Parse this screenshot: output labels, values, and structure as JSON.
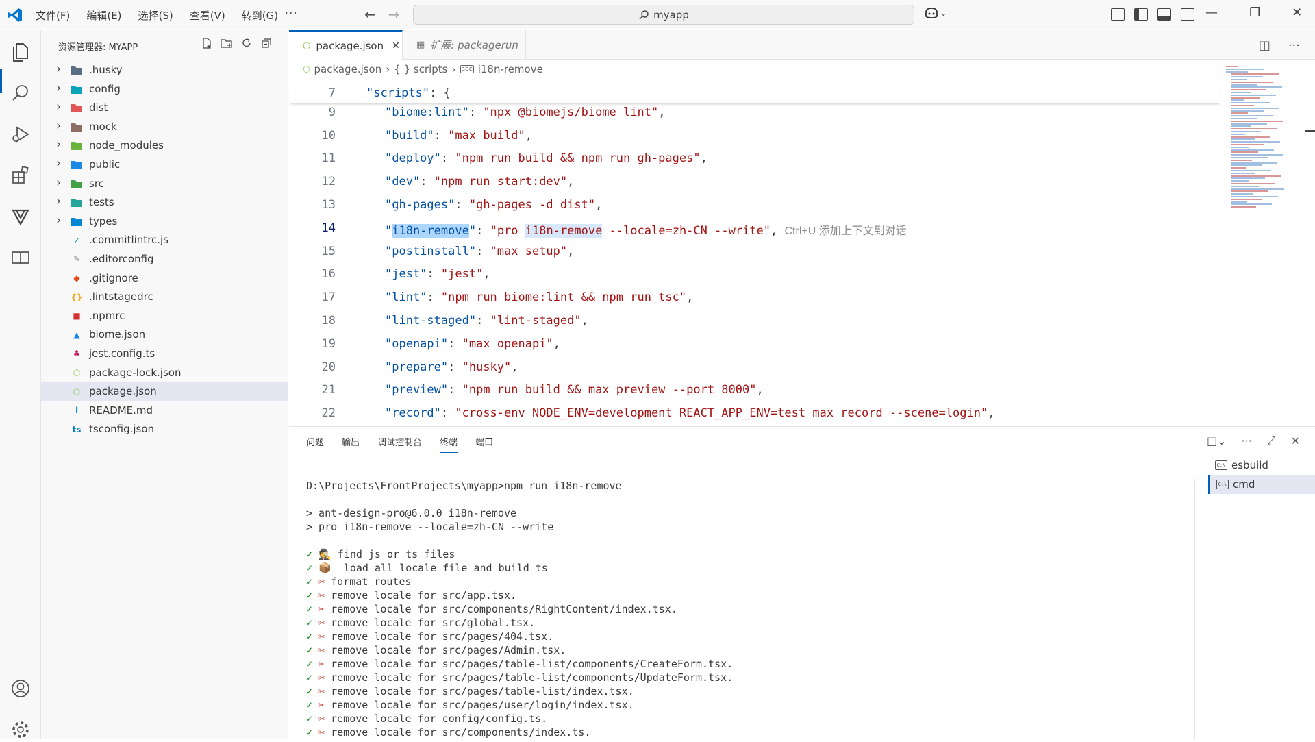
{
  "titlebar": {
    "menu": [
      "文件(F)",
      "编辑(E)",
      "选择(S)",
      "查看(V)",
      "转到(G)"
    ],
    "more": "···",
    "search_text": "myapp"
  },
  "explorer": {
    "title": "资源管理器: MYAPP",
    "items": [
      {
        "name": ".husky",
        "type": "folder",
        "color": "#5a6f84"
      },
      {
        "name": "config",
        "type": "folder",
        "color": "#0aa3b8"
      },
      {
        "name": "dist",
        "type": "folder",
        "color": "#e05555"
      },
      {
        "name": "mock",
        "type": "folder",
        "color": "#8d6e63"
      },
      {
        "name": "node_modules",
        "type": "folder",
        "color": "#6cb33e"
      },
      {
        "name": "public",
        "type": "folder",
        "color": "#1e88e5"
      },
      {
        "name": "src",
        "type": "folder",
        "color": "#43a047"
      },
      {
        "name": "tests",
        "type": "folder",
        "color": "#26a69a"
      },
      {
        "name": "types",
        "type": "folder",
        "color": "#0288d1"
      },
      {
        "name": ".commitlintrc.js",
        "type": "file",
        "color": "#26a69a",
        "glyph": "✓"
      },
      {
        "name": ".editorconfig",
        "type": "file",
        "color": "#888888",
        "glyph": "✎"
      },
      {
        "name": ".gitignore",
        "type": "file",
        "color": "#e64a19",
        "glyph": "◆"
      },
      {
        "name": ".lintstagedrc",
        "type": "file",
        "color": "#f9a825",
        "glyph": "{}"
      },
      {
        "name": ".npmrc",
        "type": "file",
        "color": "#d32f2f",
        "glyph": "■"
      },
      {
        "name": "biome.json",
        "type": "file",
        "color": "#1e88e5",
        "glyph": "▲"
      },
      {
        "name": "jest.config.ts",
        "type": "file",
        "color": "#c2185b",
        "glyph": "♣"
      },
      {
        "name": "package-lock.json",
        "type": "file",
        "color": "#8bc34a",
        "glyph": "⬡"
      },
      {
        "name": "package.json",
        "type": "file",
        "color": "#8bc34a",
        "glyph": "⬡",
        "selected": true
      },
      {
        "name": "README.md",
        "type": "file",
        "color": "#1e88e5",
        "glyph": "i"
      },
      {
        "name": "tsconfig.json",
        "type": "file",
        "color": "#0277bd",
        "glyph": "ts"
      }
    ]
  },
  "editor": {
    "tabs": [
      {
        "label": "package.json",
        "active": true
      },
      {
        "label": "扩展: packagerun",
        "active": false
      }
    ],
    "breadcrumb": [
      "package.json",
      "{ } scripts",
      "i18n-remove"
    ],
    "sticky": {
      "num": "7",
      "key": "\"scripts\"",
      "rest": ": {"
    },
    "lines": [
      {
        "num": "9",
        "key": "\"biome:lint\"",
        "val": "\"npx @biomejs/biome lint\""
      },
      {
        "num": "10",
        "key": "\"build\"",
        "val": "\"max build\""
      },
      {
        "num": "11",
        "key": "\"deploy\"",
        "val": "\"npm run build && npm run gh-pages\""
      },
      {
        "num": "12",
        "key": "\"dev\"",
        "val": "\"npm run start:dev\""
      },
      {
        "num": "13",
        "key": "\"gh-pages\"",
        "val": "\"gh-pages -d dist\""
      },
      {
        "num": "14",
        "key": "\"i18n-remove\"",
        "val": "\"pro i18n-remove --locale=zh-CN --write\"",
        "current": true,
        "hint": "Ctrl+U 添加上下文到对话"
      },
      {
        "num": "15",
        "key": "\"postinstall\"",
        "val": "\"max setup\""
      },
      {
        "num": "16",
        "key": "\"jest\"",
        "val": "\"jest\""
      },
      {
        "num": "17",
        "key": "\"lint\"",
        "val": "\"npm run biome:lint && npm run tsc\""
      },
      {
        "num": "18",
        "key": "\"lint-staged\"",
        "val": "\"lint-staged\""
      },
      {
        "num": "19",
        "key": "\"openapi\"",
        "val": "\"max openapi\""
      },
      {
        "num": "20",
        "key": "\"prepare\"",
        "val": "\"husky\""
      },
      {
        "num": "21",
        "key": "\"preview\"",
        "val": "\"npm run build && max preview --port 8000\""
      },
      {
        "num": "22",
        "key": "\"record\"",
        "val": "\"cross-env NODE_ENV=development REACT_APP_ENV=test max record --scene=login\""
      }
    ]
  },
  "panel": {
    "tabs": [
      "问题",
      "输出",
      "调试控制台",
      "终端",
      "端口"
    ],
    "active_tab": "终端",
    "terminals": [
      {
        "name": "esbuild",
        "selected": false
      },
      {
        "name": "cmd",
        "selected": true
      }
    ],
    "prompt": "D:\\Projects\\FrontProjects\\myapp>npm run i18n-remove",
    "script_lines": [
      "> ant-design-pro@6.0.0 i18n-remove",
      "> pro i18n-remove --locale=zh-CN --write"
    ],
    "log": [
      {
        "emoji": "🕵",
        "text": " find js or ts files"
      },
      {
        "emoji": "📦",
        "text": "  load all locale file and build ts"
      },
      {
        "emoji": "✂",
        "text": " format routes"
      },
      {
        "emoji": "✂",
        "text": " remove locale for src/app.tsx."
      },
      {
        "emoji": "✂",
        "text": " remove locale for src/components/RightContent/index.tsx."
      },
      {
        "emoji": "✂",
        "text": " remove locale for src/global.tsx."
      },
      {
        "emoji": "✂",
        "text": " remove locale for src/pages/404.tsx."
      },
      {
        "emoji": "✂",
        "text": " remove locale for src/pages/Admin.tsx."
      },
      {
        "emoji": "✂",
        "text": " remove locale for src/pages/table-list/components/CreateForm.tsx."
      },
      {
        "emoji": "✂",
        "text": " remove locale for src/pages/table-list/components/UpdateForm.tsx."
      },
      {
        "emoji": "✂",
        "text": " remove locale for src/pages/table-list/index.tsx."
      },
      {
        "emoji": "✂",
        "text": " remove locale for src/pages/user/login/index.tsx."
      },
      {
        "emoji": "✂",
        "text": " remove locale for config/config.ts."
      },
      {
        "emoji": "✂",
        "text": " remove locale for src/components/index.ts."
      }
    ],
    "check": "✓"
  },
  "colors": {
    "accent": "#005fb8",
    "json_key": "#0451a5",
    "json_string": "#a31515"
  }
}
